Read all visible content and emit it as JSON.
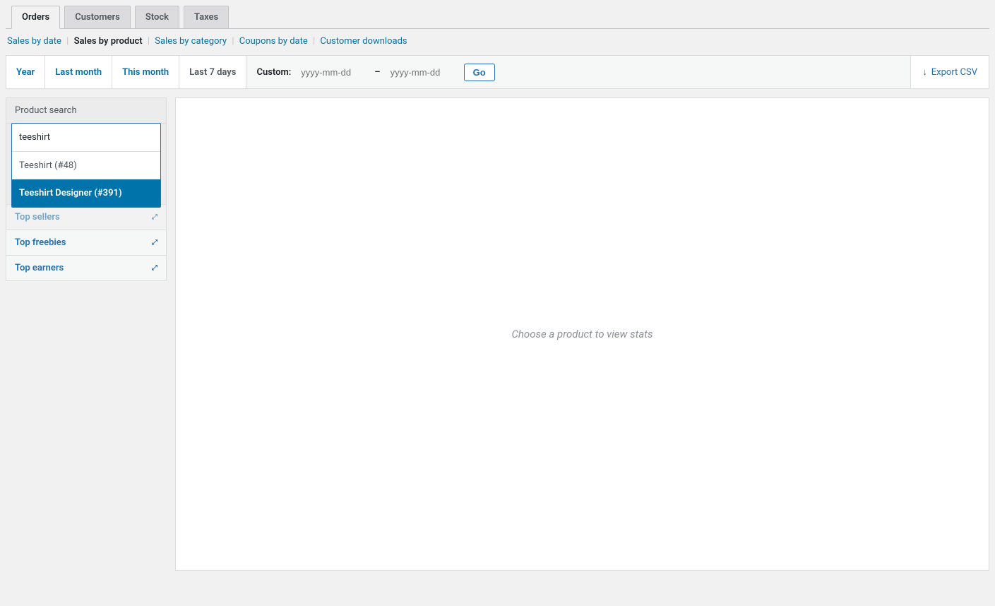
{
  "tabs": [
    {
      "label": "Orders",
      "active": true
    },
    {
      "label": "Customers",
      "active": false
    },
    {
      "label": "Stock",
      "active": false
    },
    {
      "label": "Taxes",
      "active": false
    }
  ],
  "subtabs": [
    {
      "label": "Sales by date",
      "active": false
    },
    {
      "label": "Sales by product",
      "active": true
    },
    {
      "label": "Sales by category",
      "active": false
    },
    {
      "label": "Coupons by date",
      "active": false
    },
    {
      "label": "Customer downloads",
      "active": false
    }
  ],
  "range": {
    "items": [
      "Year",
      "Last month",
      "This month",
      "Last 7 days"
    ],
    "active_index": 3,
    "custom_label": "Custom:",
    "placeholder_from": "yyyy-mm-dd",
    "dash": "–",
    "placeholder_to": "yyyy-mm-dd",
    "go_label": "Go"
  },
  "export_label": "Export CSV",
  "sidebar": {
    "header": "Product search",
    "search_value": "teeshirt",
    "options": [
      {
        "label": "Teeshirt (#48)",
        "highlight": false
      },
      {
        "label": "Teeshirt Designer (#391)",
        "highlight": true
      }
    ],
    "panels": [
      {
        "label": "Top sellers"
      },
      {
        "label": "Top freebies"
      },
      {
        "label": "Top earners"
      }
    ]
  },
  "main": {
    "placeholder": "Choose a product to view stats"
  }
}
